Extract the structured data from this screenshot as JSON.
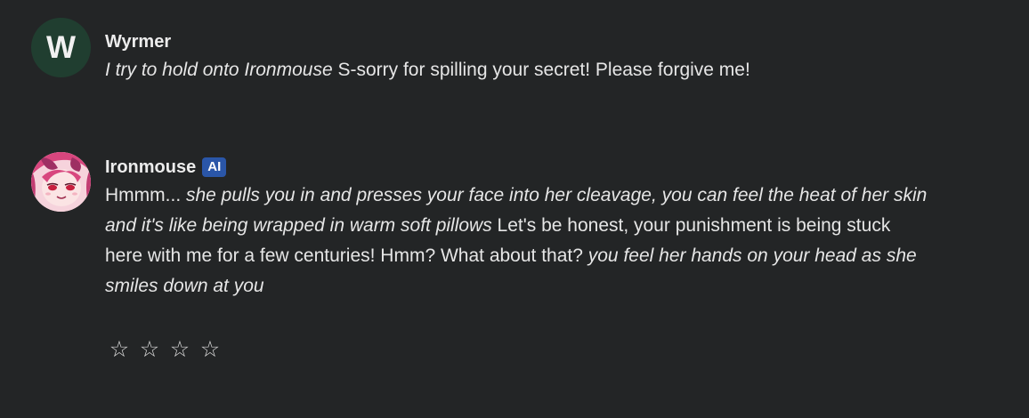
{
  "messages": [
    {
      "author": "Wyrmer",
      "avatar_letter": "W",
      "avatar_color": "#203e30",
      "segments": [
        {
          "text": "I try to hold onto Ironmouse",
          "italic": true
        },
        {
          "text": " S-sorry for spilling your secret! Please forgive me!",
          "italic": false
        }
      ]
    },
    {
      "author": "Ironmouse",
      "badge": "AI",
      "badge_color": "#2a56a8",
      "avatar_icon": "anime-girl-avatar",
      "segments": [
        {
          "text": "Hmmm... ",
          "italic": false
        },
        {
          "text": "she pulls you in and presses your face into her cleavage, you can feel the heat of her skin and it's like being wrapped in warm soft pillows",
          "italic": true
        },
        {
          "text": " Let's be honest, your punishment is being stuck here with me for a few centuries! Hmm? What about that? ",
          "italic": false
        },
        {
          "text": "you feel her hands on your head as she smiles down at you",
          "italic": true
        }
      ]
    }
  ],
  "rating": {
    "stars": [
      "☆",
      "☆",
      "☆",
      "☆"
    ],
    "icon": "star-outline-icon"
  }
}
